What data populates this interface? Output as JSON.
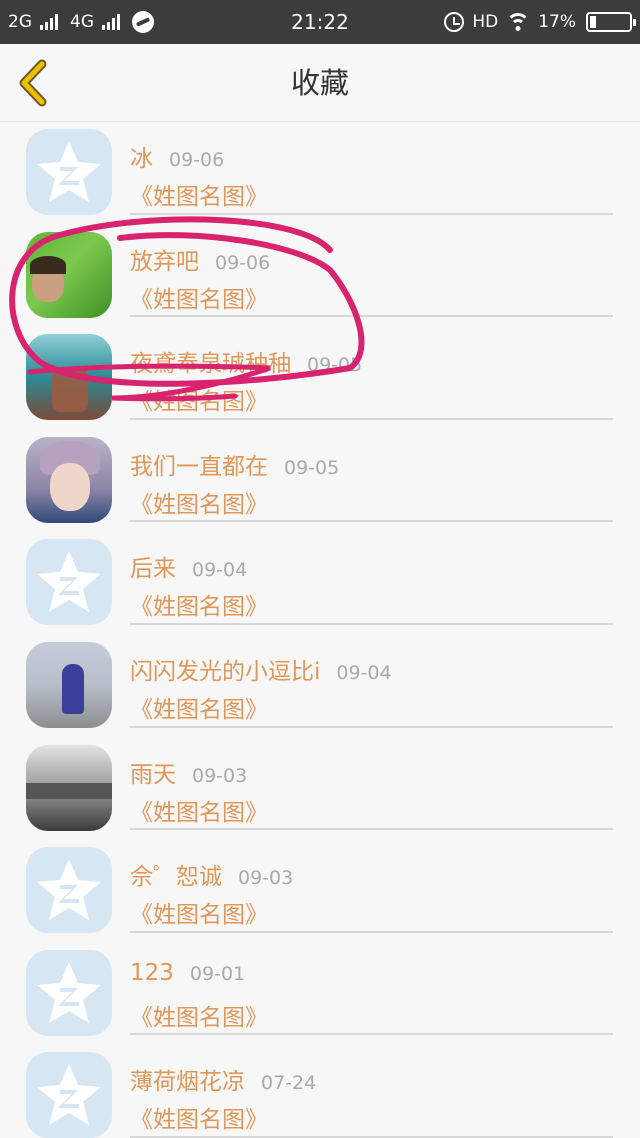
{
  "status_bar": {
    "network_1": "2G",
    "network_2": "4G",
    "time": "21:22",
    "hd": "HD",
    "battery_percent": "17%",
    "battery_level": 0.17
  },
  "nav": {
    "title": "收藏",
    "back_icon": "chevron-left-icon"
  },
  "colors": {
    "accent": "#e0975a",
    "back_arrow": "#f0c000",
    "annotation": "#d8246e"
  },
  "favorites": [
    {
      "name": "冰",
      "date": "09-06",
      "subtitle": "《姓图名图》",
      "avatar": "default"
    },
    {
      "name": "放弃吧",
      "date": "09-06",
      "subtitle": "《姓图名图》",
      "avatar": "photo-green"
    },
    {
      "name": "夜鳶奉泉珹秞秞",
      "date": "09-05",
      "subtitle": "《姓图名图》",
      "avatar": "photo-teal"
    },
    {
      "name": "我们一直都在",
      "date": "09-05",
      "subtitle": "《姓图名图》",
      "avatar": "photo-boy"
    },
    {
      "name": "后来",
      "date": "09-04",
      "subtitle": "《姓图名图》",
      "avatar": "default"
    },
    {
      "name": "闪闪发光的小逗比i",
      "date": "09-04",
      "subtitle": "《姓图名图》",
      "avatar": "photo-street"
    },
    {
      "name": "雨天",
      "date": "09-03",
      "subtitle": "《姓图名图》",
      "avatar": "photo-bw"
    },
    {
      "name": "佘゜恕诚",
      "date": "09-03",
      "subtitle": "《姓图名图》",
      "avatar": "default"
    },
    {
      "name": "123",
      "date": "09-01",
      "subtitle": "《姓图名图》",
      "avatar": "default"
    },
    {
      "name": "薄荷烟花凉",
      "date": "07-24",
      "subtitle": "《姓图名图》",
      "avatar": "default"
    }
  ]
}
